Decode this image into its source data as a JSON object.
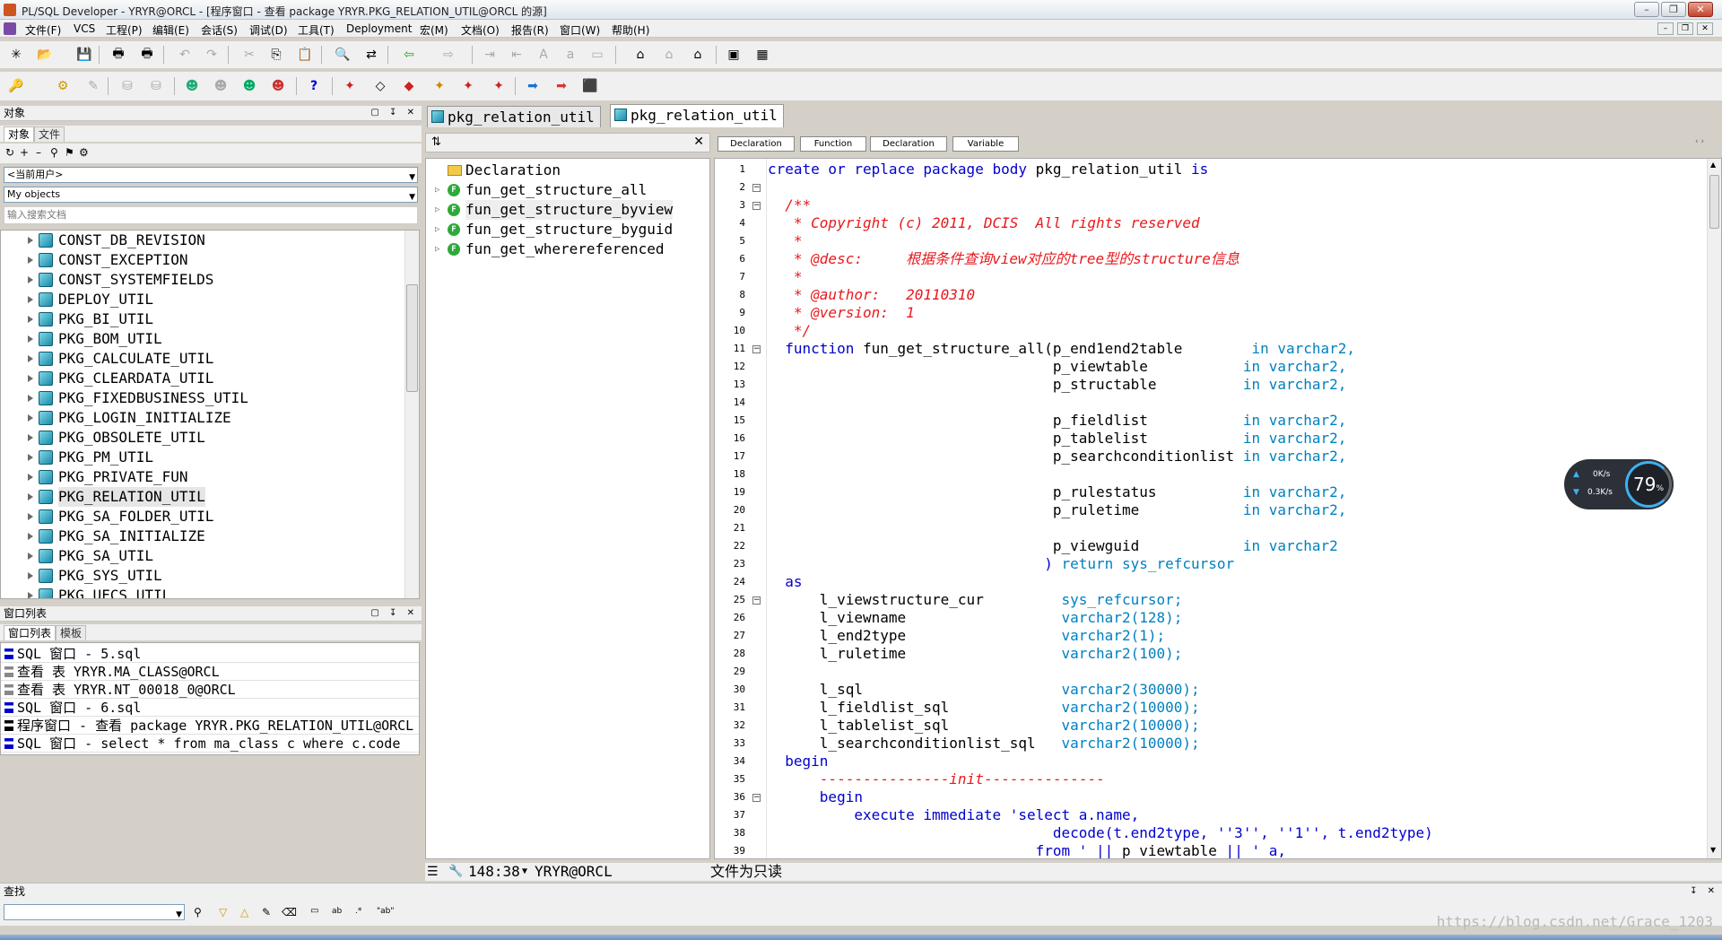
{
  "window": {
    "title": "PL/SQL Developer - YRYR@ORCL - [程序窗口 - 查看 package YRYR.PKG_RELATION_UTIL@ORCL 的源]"
  },
  "menu": [
    "文件(F)",
    "VCS",
    "工程(P)",
    "编辑(E)",
    "会话(S)",
    "调试(D)",
    "工具(T)",
    "Deployment",
    "宏(M)",
    "文档(O)",
    "报告(R)",
    "窗口(W)",
    "帮助(H)"
  ],
  "objects_panel": {
    "header": "对象",
    "tabs": [
      "对象",
      "文件"
    ],
    "user_combo": "<当前用户>",
    "filter_combo": "My objects",
    "search_placeholder": "输入搜索文档",
    "items": [
      "CONST_DB_REVISION",
      "CONST_EXCEPTION",
      "CONST_SYSTEMFIELDS",
      "DEPLOY_UTIL",
      "PKG_BI_UTIL",
      "PKG_BOM_UTIL",
      "PKG_CALCULATE_UTIL",
      "PKG_CLEARDATA_UTIL",
      "PKG_FIXEDBUSINESS_UTIL",
      "PKG_LOGIN_INITIALIZE",
      "PKG_OBSOLETE_UTIL",
      "PKG_PM_UTIL",
      "PKG_PRIVATE_FUN",
      "PKG_RELATION_UTIL",
      "PKG_SA_FOLDER_UTIL",
      "PKG_SA_INITIALIZE",
      "PKG_SA_UTIL",
      "PKG_SYS_UTIL",
      "PKG_UFCS_UTIL"
    ]
  },
  "window_list": {
    "header": "窗口列表",
    "tabs": [
      "窗口列表",
      "模板"
    ],
    "items": [
      "SQL 窗口 - 5.sql",
      "查看 表 YRYR.MA_CLASS@ORCL",
      "查看 表 YRYR.NT_00018_0@ORCL",
      "SQL 窗口 - 6.sql",
      "程序窗口 - 查看 package YRYR.PKG_RELATION_UTIL@ORCL 的源",
      "SQL 窗口 - select * from ma_class c where c.code"
    ]
  },
  "doc_tabs": [
    "pkg_relation_util",
    "pkg_relation_util"
  ],
  "outline": {
    "items": [
      "Declaration",
      "fun_get_structure_all",
      "fun_get_structure_byview",
      "fun_get_structure_byguid",
      "fun_get_wherereferenced"
    ]
  },
  "code_tabs": [
    "Declaration",
    "Function",
    "Declaration",
    "Variable"
  ],
  "code": {
    "line_numbers": [
      "1",
      "2",
      "3",
      "4",
      "5",
      "6",
      "7",
      "8",
      "9",
      "10",
      "11",
      "12",
      "13",
      "14",
      "15",
      "16",
      "17",
      "18",
      "19",
      "20",
      "21",
      "22",
      "23",
      "24",
      "25",
      "26",
      "27",
      "28",
      "29",
      "30",
      "31",
      "32",
      "33",
      "34",
      "35",
      "36",
      "37",
      "38",
      "39"
    ],
    "l1a": "create or replace package body",
    "l1b": " pkg_relation_util ",
    "l1c": "is",
    "l3": "  /**",
    "l4": "   * Copyright (c) 2011, DCIS  All rights reserved",
    "l5": "   *",
    "l6": "   * @desc:     根据条件查询view对应的tree型的structure信息",
    "l7": "   *",
    "l8": "   * @author:   20110310",
    "l9": "   * @version:  1",
    "l10": "   */",
    "l11a": "  function",
    "l11b": " fun_get_structure_all(p_end1end2table        ",
    "l11c": "in varchar2,",
    "l12a": "                                 p_viewtable           ",
    "l13a": "                                 p_structable          ",
    "l15a": "                                 p_fieldlist           ",
    "l16a": "                                 p_tablelist           ",
    "l17a": "                                 p_searchconditionlist ",
    "l19a": "                                 p_rulestatus          ",
    "l20a": "                                 p_ruletime            ",
    "l22a": "                                 p_viewguid            ",
    "l22c": "in varchar2",
    "l23a": "                                ) ",
    "l23b": "return sys_refcursor",
    "l24": "  as",
    "l25a": "      l_viewstructure_cur         ",
    "l25b": "sys_refcursor;",
    "l26a": "      l_viewname                  ",
    "l26b": "varchar2(128);",
    "l27a": "      l_end2type                  ",
    "l27b": "varchar2(1);",
    "l28a": "      l_ruletime                  ",
    "l28b": "varchar2(100);",
    "l30a": "      l_sql                       ",
    "l30b": "varchar2(30000);",
    "l31a": "      l_fieldlist_sql             ",
    "l31b": "varchar2(10000);",
    "l32a": "      l_tablelist_sql             ",
    "l32b": "varchar2(10000);",
    "l33a": "      l_searchconditionlist_sql   ",
    "l33b": "varchar2(10000);",
    "l34": "  begin",
    "l35a": "      ---------------",
    "l35b": "init",
    "l35c": "--------------",
    "l36": "      begin",
    "l37a": "          execute immediate ",
    "l37b": "'select a.name,",
    "l38a": "                                 ",
    "l38b": "decode(t.end2type, ''3'', ''1'', t.end2type)",
    "l39a": "                               from ",
    "l39b": "' || ",
    "l39c": "p_viewtable",
    "l39d": " || ' a,"
  },
  "status": {
    "position": "148:38",
    "connection": "YRYR@ORCL",
    "message": "文件为只读"
  },
  "find": {
    "header": "查找"
  },
  "net_widget": {
    "up": "0K/s",
    "down": "0.3K/s",
    "percent": "79",
    "percent_unit": "%"
  },
  "watermark": "https://blog.csdn.net/Grace_1203"
}
